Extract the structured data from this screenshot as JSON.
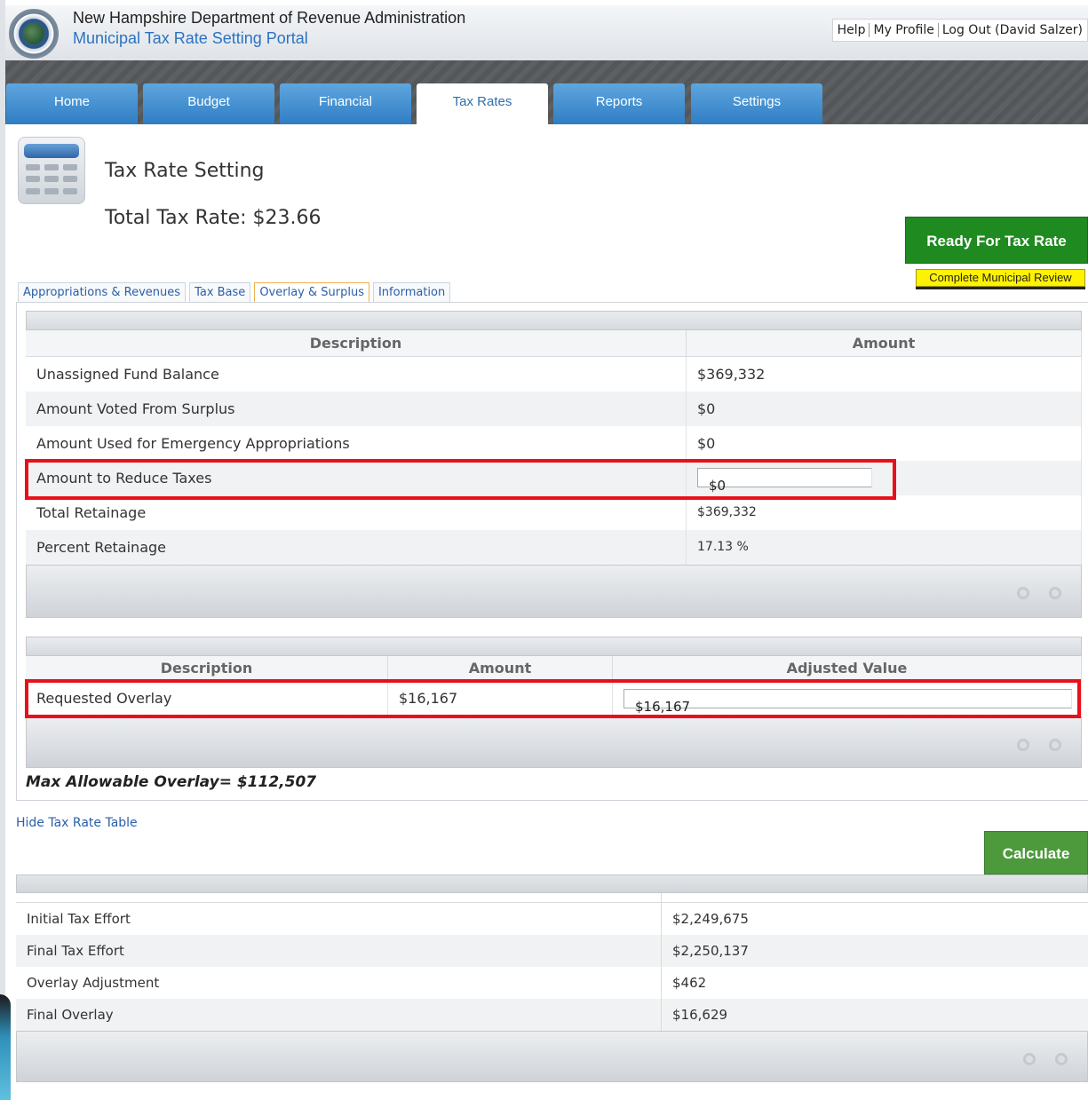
{
  "header": {
    "org_title": "New Hampshire Department of Revenue Administration",
    "portal_title": "Municipal Tax Rate Setting Portal",
    "links": {
      "help": "Help",
      "profile": "My Profile",
      "logout": "Log Out (David Salzer)"
    }
  },
  "nav": {
    "tabs": [
      {
        "label": "Home"
      },
      {
        "label": "Budget"
      },
      {
        "label": "Financial"
      },
      {
        "label": "Tax Rates"
      },
      {
        "label": "Reports"
      },
      {
        "label": "Settings"
      }
    ],
    "active": "Tax Rates"
  },
  "page": {
    "title": "Tax Rate Setting",
    "total_rate": "Total Tax Rate: $23.66",
    "status_label": "Ready For Tax Rate",
    "review_button": "Complete Municipal Review"
  },
  "subtabs": [
    {
      "label": "Appropriations & Revenues"
    },
    {
      "label": "Tax Base"
    },
    {
      "label": "Overlay & Surplus"
    },
    {
      "label": "Information"
    }
  ],
  "surplus_table": {
    "headers": {
      "description": "Description",
      "amount": "Amount"
    },
    "rows": [
      {
        "description": "Unassigned Fund Balance",
        "amount": "$369,332"
      },
      {
        "description": "Amount Voted From Surplus",
        "amount": "$0"
      },
      {
        "description": "Amount Used for Emergency Appropriations",
        "amount": "$0"
      },
      {
        "description": "Amount to Reduce Taxes",
        "amount": "$0"
      },
      {
        "description": "Total Retainage",
        "amount": "$369,332"
      },
      {
        "description": "Percent Retainage",
        "amount": "17.13 %"
      }
    ]
  },
  "overlay_table": {
    "headers": {
      "description": "Description",
      "amount": "Amount",
      "adjusted": "Adjusted Value"
    },
    "row": {
      "description": "Requested Overlay",
      "amount": "$16,167",
      "adjusted": "$16,167"
    }
  },
  "max_overlay": "Max Allowable Overlay= $112,507",
  "hide_link": "Hide Tax Rate Table",
  "calculate_button": "Calculate",
  "summary_table": {
    "rows": [
      {
        "label": "Initial Tax Effort",
        "value": "$2,249,675"
      },
      {
        "label": "Final Tax Effort",
        "value": "$2,250,137"
      },
      {
        "label": "Overlay Adjustment",
        "value": "$462"
      },
      {
        "label": "Final Overlay",
        "value": "$16,629"
      }
    ]
  },
  "colors": {
    "nav_tab": "#2f7dc4",
    "ready_green": "#1f8a1f",
    "review_yellow": "#fff200",
    "calculate_green": "#4c9a3c",
    "highlight_red": "#e8101a",
    "link_blue": "#2b5fa8"
  }
}
